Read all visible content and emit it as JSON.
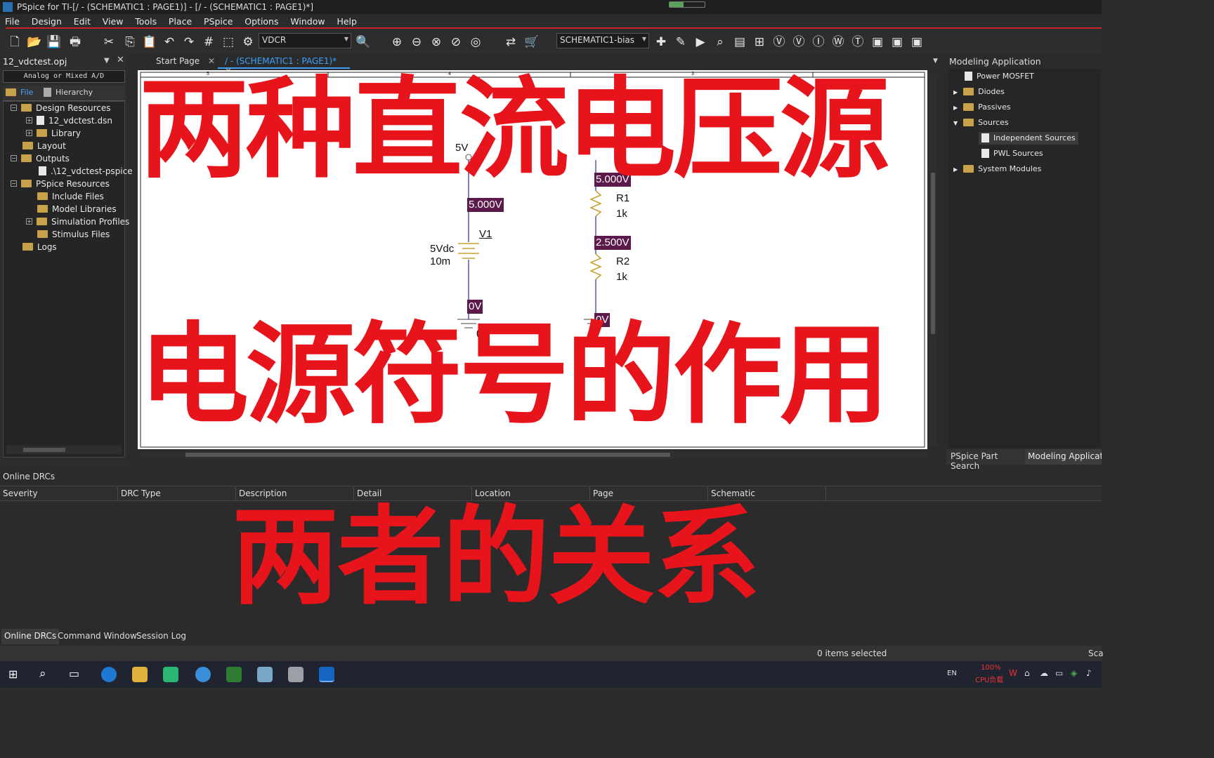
{
  "window": {
    "title": "PSpice for TI-[/ - (SCHEMATIC1 : PAGE1)] - [/ - (SCHEMATIC1 : PAGE1)*]"
  },
  "menu": [
    "File",
    "Design",
    "Edit",
    "View",
    "Tools",
    "Place",
    "PSpice",
    "Options",
    "Window",
    "Help"
  ],
  "toolbar": {
    "part_combo": "VDCR",
    "profile_combo": "SCHEMATIC1-bias"
  },
  "project": {
    "name": "12_vdctest.opj",
    "analog_label": "Analog or Mixed A/D",
    "tabs": [
      "File",
      "Hierarchy"
    ],
    "tree": [
      {
        "label": "Design Resources"
      },
      {
        "label": "12_vdctest.dsn"
      },
      {
        "label": "Library"
      },
      {
        "label": "Layout"
      },
      {
        "label": "Outputs"
      },
      {
        "label": ".\\12_vdctest-pspice"
      },
      {
        "label": "PSpice Resources"
      },
      {
        "label": "Include Files"
      },
      {
        "label": "Model Libraries"
      },
      {
        "label": "Simulation Profiles"
      },
      {
        "label": "Stimulus Files"
      },
      {
        "label": "Logs"
      }
    ]
  },
  "doc_tabs": [
    "Start Page",
    "/ - (SCHEMATIC1 : PAGE1)*"
  ],
  "schematic": {
    "v1_net": "5V",
    "v1_top_voltage": "5.000V",
    "v1_name": "V1",
    "v1_value": "5Vdc",
    "v1_tol": "10m",
    "v1_bottom_voltage": "0V",
    "ground_label": "0",
    "r_top_net": "5",
    "r_top_voltage": "5.000V",
    "r1_name": "R1",
    "r1_value": "1k",
    "mid_voltage": "2.500V",
    "r2_name": "R2",
    "r2_value": "1k",
    "r_bottom_voltage": "0V",
    "ruler": [
      "5",
      "4",
      "3"
    ]
  },
  "overlay": {
    "line1": "两种直流电压源",
    "line2": "电源符号的作用",
    "line3": "两者的关系"
  },
  "modeling": {
    "title": "Modeling Application",
    "items": [
      {
        "label": "Power MOSFET"
      },
      {
        "label": "Diodes"
      },
      {
        "label": "Passives"
      },
      {
        "label": "Sources"
      },
      {
        "label": "Independent Sources"
      },
      {
        "label": "PWL Sources"
      },
      {
        "label": "System Modules"
      }
    ],
    "bottom_tabs": [
      "PSpice Part Search",
      "Modeling Applicatic"
    ]
  },
  "drc": {
    "title": "Online DRCs",
    "columns": [
      "Severity",
      "DRC Type",
      "Description",
      "Detail",
      "Location",
      "Page",
      "Schematic"
    ],
    "tabs": [
      "Online DRCs",
      "Command Window",
      "Session Log"
    ]
  },
  "status": {
    "selected": "0 items selected",
    "right": "Sca"
  },
  "taskbar": {
    "lang": "EN",
    "cpu_pct": "100%",
    "cpu_label": "CPU负载"
  },
  "colors": {
    "accent_red": "#e8141c",
    "voltage_marker": "#5c1a4a"
  }
}
